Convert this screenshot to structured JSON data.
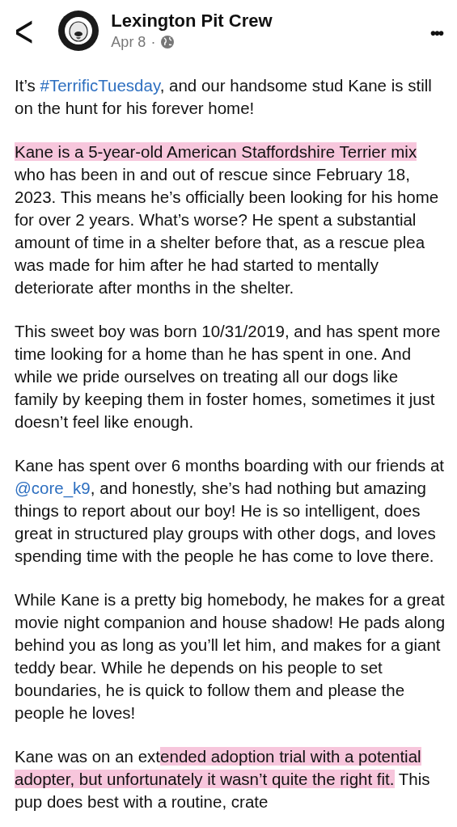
{
  "header": {
    "back": "<",
    "page_name": "Lexington Pit Crew",
    "date": "Apr 8",
    "separator": "·",
    "more": "•••"
  },
  "paragraphs": [
    [
      {
        "kind": "text",
        "text": "It’s ",
        "highlighted": false
      },
      {
        "kind": "link",
        "text": "#TerrificTuesday",
        "highlighted": false
      },
      {
        "kind": "text",
        "text": ", and our handsome stud Kane is still on the hunt for his forever home!",
        "highlighted": false
      }
    ],
    [
      {
        "kind": "text",
        "text": "Kane is a 5-year-old American Staffordshire Terrier mix",
        "highlighted": true
      },
      {
        "kind": "text",
        "text": " who has been in and out of rescue since February 18, 2023. This means he’s officially been looking for his home for over 2 years. What’s worse? He spent a substantial amount of time in a shelter before that, as a rescue plea was made for him after he had started to mentally deteriorate after months in the shelter.",
        "highlighted": false
      }
    ],
    [
      {
        "kind": "text",
        "text": "This sweet boy was born 10/31/2019, and has spent more time looking for a home than he has spent in one. And while we pride ourselves on treating all our dogs like family by keeping them in foster homes, sometimes it just doesn’t feel like enough.",
        "highlighted": false
      }
    ],
    [
      {
        "kind": "text",
        "text": "Kane has spent over 6 months boarding with our friends at ",
        "highlighted": false
      },
      {
        "kind": "link",
        "text": "@core_k9",
        "highlighted": false
      },
      {
        "kind": "text",
        "text": ", and honestly, she’s had nothing but amazing things to report about our boy! He is so intelligent, does great in structured play groups with other dogs, and loves spending time with the people he has come to love there.",
        "highlighted": false
      }
    ],
    [
      {
        "kind": "text",
        "text": "While Kane is a pretty big homebody, he makes for a great movie night companion and house shadow! He pads along behind you as long as you’ll let him, and makes for a giant teddy bear. While he depends on his people to set boundaries, he is quick to follow them and please the people he loves!",
        "highlighted": false
      }
    ],
    [
      {
        "kind": "text",
        "text": "Kane was on an ext",
        "highlighted": false
      },
      {
        "kind": "text",
        "text": "ended adoption trial with a potential adopter, but unfortunately it wasn’t quite the right fit.",
        "highlighted": true
      },
      {
        "kind": "text",
        "text": " This pup does best with a routine, crate",
        "highlighted": false
      }
    ]
  ]
}
